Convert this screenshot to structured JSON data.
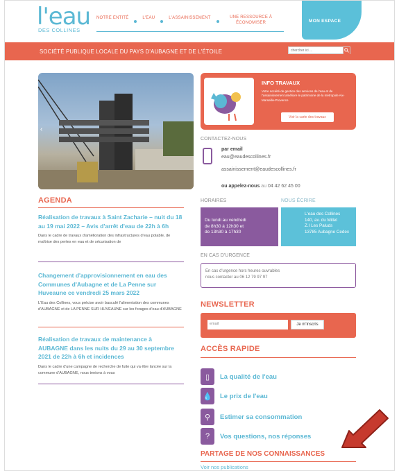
{
  "header": {
    "logo_main": "l'eau",
    "logo_sub": "DES COLLINES",
    "nav": [
      "NOTRE ENTITÉ",
      "L'EAU",
      "L'ASSAINISSEMENT",
      "UNE RESSOURCE À ÉCONOMISER"
    ],
    "space_button": "MON ESPACE",
    "banner": "SOCIÉTÉ PUBLIQUE LOCALE DU PAYS D'AUBAGNE ET DE L'ÉTOILE",
    "search_placeholder": "chercher ici ..."
  },
  "agenda": {
    "title": "AGENDA",
    "items": [
      {
        "title": "Réalisation de travaux à Saint Zacharie – nuit du 18 au 19 mai 2022 – Avis d'arrêt d'eau de 22h à 6h",
        "desc": "Dans le cadre de travaux d'amélioration des infrastructures d'eau potable, de maîtrise des pertes en eau et de sécurisation de"
      },
      {
        "title": "Changement d'approvisionnement en eau des Communes d'Aubagne et de La Penne sur Huveaune ce vendredi 25 mars 2022",
        "desc": "L'Eau des Collines, vous précise avoir basculé l'alimentation des communes d'AUBAGNE et de LA PENNE SUR HUVEAUNE sur les forages d'eau d'AUBAGNE"
      },
      {
        "title": "Réalisation de travaux de maintenance à AUBAGNE dans les nuits du 29 au 30 septembre 2021 de 22h à 6h et incidences",
        "desc": "Dans le cadre d'une campagne de recherche de fuite qui va être lancée sur la commune d'AUBAGNE, nous tenions à vous"
      }
    ]
  },
  "info_travaux": {
    "title": "INFO TRAVAUX",
    "text": "Votre société de gestion des services de l'eau et de l'assainissement améliore le patrimoine de la métropole Aix-Marseille-Provence",
    "button": "Voir la carte des travaux"
  },
  "contact": {
    "title": "CONTACTEZ-NOUS",
    "by_email": "par email",
    "email_1": "eau@eaudescollines.fr",
    "email_2": "assainissement@eaudescollines.fr",
    "call_label": "ou appelez-nous",
    "call_at": "au",
    "phone": "04 42 62 45 00"
  },
  "hours": {
    "title": "HORAIRES",
    "lines": [
      "Du lundi au vendredi",
      "de 8h30 à 12h30 et",
      "de 13h30 à 17h30"
    ]
  },
  "write": {
    "title": "NOUS ÉCRIRE",
    "lines": [
      "L'eau des Collines",
      "140, av. du Millet",
      "Z.I Les Paluds",
      "13785 Aubagne Cedex"
    ]
  },
  "urgence": {
    "title": "EN CAS D'URGENCE",
    "lines": [
      "En cas d'urgence hors heures ouvrables",
      "nous contacter au 06 12 79 97 97"
    ]
  },
  "newsletter": {
    "title": "NEWSLETTER",
    "placeholder": "email",
    "button": "Je m'inscris"
  },
  "acces_rapide": {
    "title": "ACCÈS RAPIDE",
    "items": [
      {
        "label": "La qualité de l'eau",
        "icon": "glass-icon"
      },
      {
        "label": "Le prix de l'eau",
        "icon": "hand-drop-icon"
      },
      {
        "label": "Estimer sa consommation",
        "icon": "tap-icon"
      },
      {
        "label": "Vos questions, nos réponses",
        "icon": "question-drop-icon"
      }
    ]
  },
  "partage": {
    "title": "PARTAGE DE NOS CONNAISSANCES",
    "link": "Voir nos publications"
  },
  "colors": {
    "orange": "#e8664f",
    "blue": "#5bb8d4",
    "purple": "#8a5a9e",
    "arrow_red": "#c63a2e"
  }
}
